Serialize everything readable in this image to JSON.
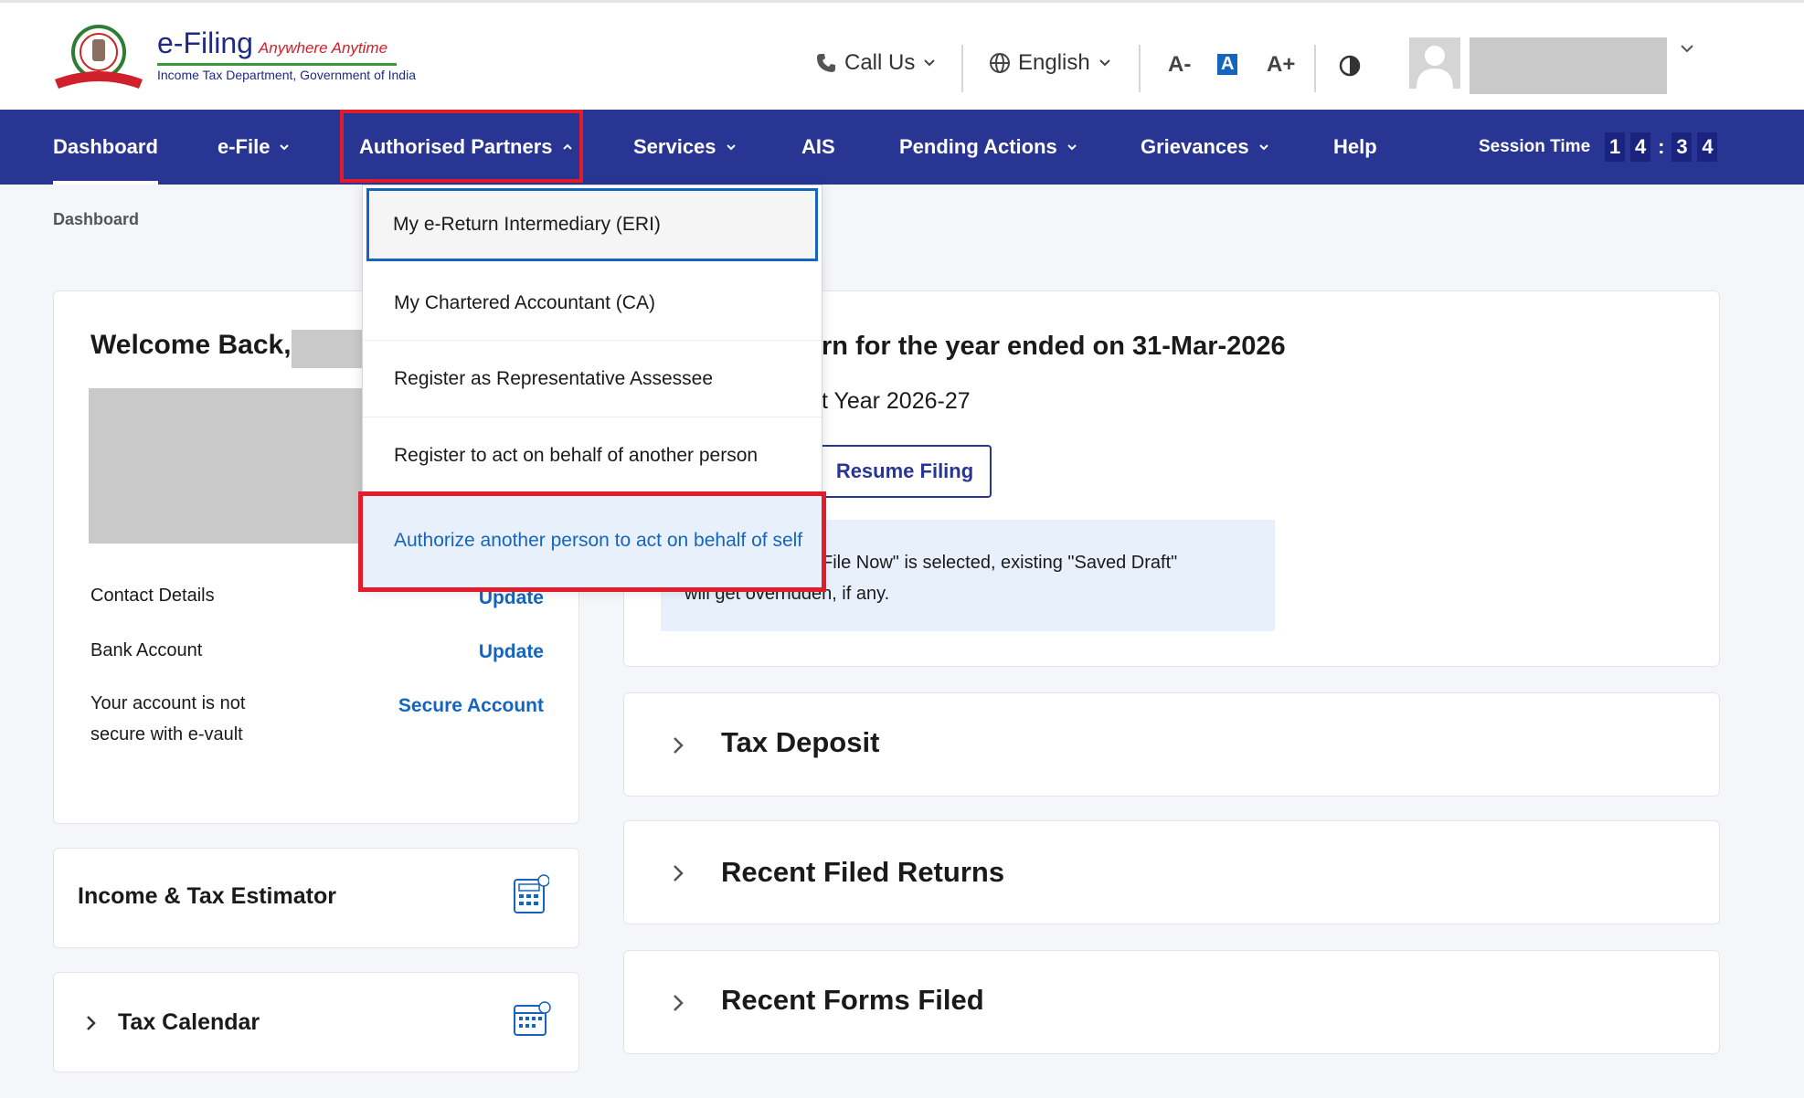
{
  "header": {
    "logo": {
      "title": "e-Filing",
      "tagline": "Anywhere Anytime",
      "subtitle": "Income Tax Department, Government of India"
    },
    "call_us": "Call Us",
    "language": "English",
    "font_decrease": "A-",
    "font_normal": "A",
    "font_increase": "A+"
  },
  "nav": {
    "items": [
      {
        "label": "Dashboard"
      },
      {
        "label": "e-File"
      },
      {
        "label": "Authorised Partners"
      },
      {
        "label": "Services"
      },
      {
        "label": "AIS"
      },
      {
        "label": "Pending Actions"
      },
      {
        "label": "Grievances"
      },
      {
        "label": "Help"
      }
    ],
    "session_label": "Session Time",
    "session_digits": [
      "1",
      "4",
      "3",
      "4"
    ]
  },
  "breadcrumb": "Dashboard",
  "welcome": {
    "title": "Welcome Back,",
    "contact_label": "Contact Details",
    "contact_action": "Update",
    "bank_label": "Bank Account",
    "bank_action": "Update",
    "vault_label": "Your account is not secure with e-vault",
    "vault_action": "Secure Account"
  },
  "estimator": {
    "title": "Income & Tax Estimator"
  },
  "calendar": {
    "title": "Tax Calendar"
  },
  "itr": {
    "title_visible": "rn for the year ended on 31-Mar-2026",
    "subtitle_visible": "t Year 2026-27",
    "resume_button": "Resume Filing",
    "info_line1_visible": "File Now\" is selected, existing \"Saved Draft\"",
    "info_line2_visible": "will get overridden, if any."
  },
  "accordions": [
    {
      "title": "Tax Deposit"
    },
    {
      "title": "Recent Filed Returns"
    },
    {
      "title": "Recent Forms Filed"
    }
  ],
  "dropdown": {
    "items": [
      {
        "label": "My e-Return Intermediary (ERI)"
      },
      {
        "label": "My Chartered Accountant (CA)"
      },
      {
        "label": "Register as Representative Assessee"
      },
      {
        "label": "Register to act on behalf of another person"
      },
      {
        "label": "Authorize another person to act on behalf of self"
      }
    ]
  },
  "colors": {
    "nav_bg": "#283593",
    "link": "#1565c0",
    "highlight_red": "#e21c2a"
  }
}
